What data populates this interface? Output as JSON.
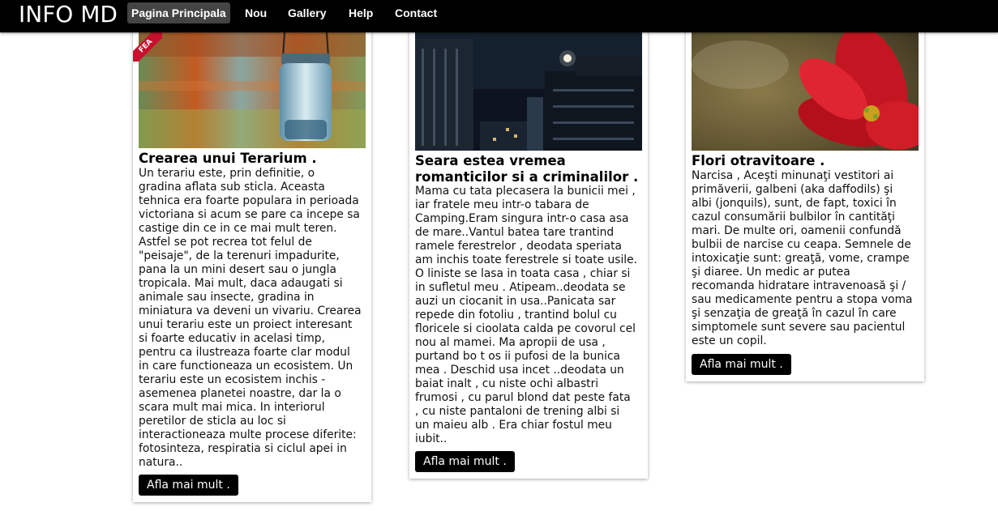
{
  "nav": {
    "brand": "INFO MD",
    "links": [
      "Pagina Principala",
      "Nou",
      "Gallery",
      "Help",
      "Contact"
    ],
    "active": "Pagina Principala"
  },
  "posts": [
    {
      "image_alt": "Jar hanging on string",
      "ribbon": "FEA",
      "title": "Crearea unui Terarium .",
      "lines": [
        "Un terariu este, prin definitie, o",
        "gradina aflata sub sticla. Aceasta",
        "tehnica era foarte populara in perioada",
        "victoriana si acum se pare ca incepe sa",
        "castige din ce in ce mai mult teren.",
        "Astfel se pot recrea tot felul de",
        "\"peisaje\", de la terenuri impadurite,",
        "pana la un mini desert sau o jungla",
        "tropicala. Mai mult, daca adaugati si",
        "animale sau insecte, gradina in",
        "miniatura va deveni un vivariu. Crearea",
        "unui terariu este un proiect interesant",
        "si foarte educativ in acelasi timp,",
        "pentru ca ilustreaza foarte clar modul",
        "in care functioneaza un ecosistem. Un",
        "terariu este un ecosistem inchis -",
        "asemenea planetei noastre, dar la o",
        "scara mult mai mica. In interiorul",
        "peretilor de sticla au loc si",
        "interactioneaza multe procese diferite:",
        "fotosinteza, respiratia si ciclul apei in",
        "natura.."
      ],
      "button": "Afla mai mult ."
    },
    {
      "image_alt": "City at night",
      "title_lines": [
        "Seara estea vremea",
        "romanticilor si a criminalilor ."
      ],
      "lines": [
        "Mama cu tata plecasera la bunicii mei ,",
        "iar fratele meu intr-o tabara de",
        "Camping.Eram singura intr-o casa asa",
        "de mare..Vantul batea tare trantind",
        "ramele ferestrelor , deodata speriata",
        "am inchis toate ferestrele si toate usile.",
        "O liniste se lasa in toata casa , chiar si",
        "in sufletul meu . Atipeam..deodata se",
        "auzi un ciocanit in usa..Panicata sar",
        "repede din fotoliu , trantind bolul cu",
        "floricele si cioolata calda pe covorul cel",
        "nou al mamei. Ma apropii de usa ,",
        "purtand bo t os ii pufosi de la bunica",
        "mea . Deschid usa incet ..deodata un",
        "baiat inalt , cu niste ochi albastri",
        "frumosi , cu parul blond dat peste fata",
        ", cu niste pantaloni de trening albi si",
        "un maieu alb . Era chiar fostul meu",
        "iubit.."
      ],
      "button": "Afla mai mult ."
    },
    {
      "image_alt": "Red poinsettia flower",
      "title": "Flori otravitoare .",
      "lines": [
        "Narcisa , Aceşti minunaţi vestitori ai",
        "primăverii, galbeni (aka daffodils) şi",
        "albi (jonquils), sunt, de fapt, toxici în",
        "cazul consumării bulbilor în cantităţi",
        "mari. De multe ori, oamenii confundă",
        "bulbii de narcise cu ceapa. Semnele de",
        "intoxicaţie sunt: greaţă, vome, crampe",
        "şi diaree. Un medic ar putea",
        "recomanda hidratare intravenoasă şi /",
        "sau medicamente pentru a stopa voma",
        "şi senzaţia de greaţă în cazul în care",
        "simptomele sunt severe sau pacientul",
        "este un copil."
      ],
      "button": "Afla mai mult ."
    }
  ]
}
